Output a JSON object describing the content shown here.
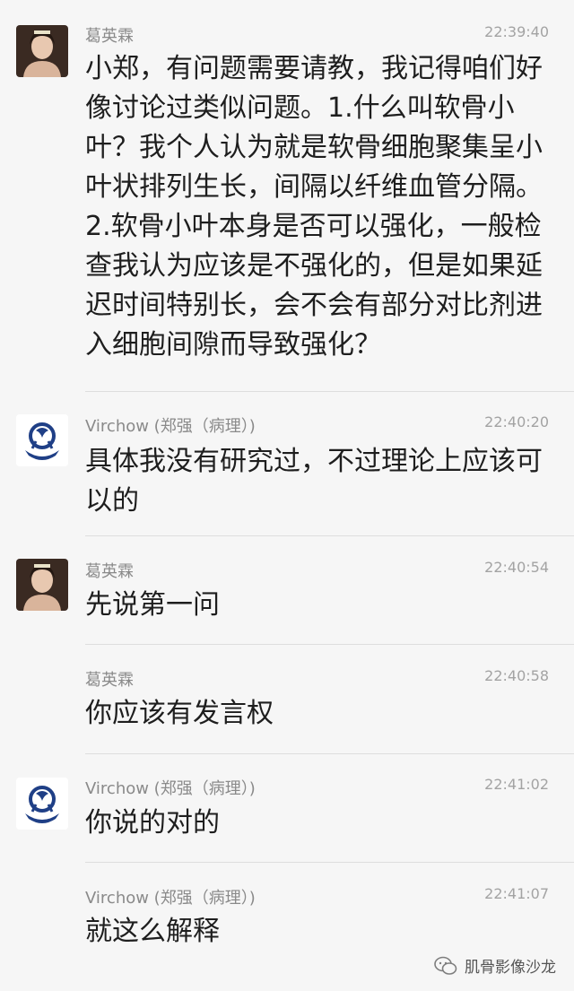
{
  "messages": [
    {
      "sender": "葛英霖",
      "time": "22:39:40",
      "avatar": "female-portrait",
      "text": "小郑，有问题需要请教，我记得咱们好像讨论过类似问题。1.什么叫软骨小叶？我个人认为就是软骨细胞聚集呈小叶状排列生长，间隔以纤维血管分隔。2.软骨小叶本身是否可以强化，一般检查我认为应该是不强化的，但是如果延迟时间特别长，会不会有部分对比剂进入细胞间隙而导致强化？"
    },
    {
      "sender": "Virchow (郑强（病理）)",
      "time": "22:40:20",
      "avatar": "blue-emblem",
      "text": "具体我没有研究过，不过理论上应该可以的"
    },
    {
      "sender": "葛英霖",
      "time": "22:40:54",
      "avatar": "female-portrait",
      "text": "先说第一问"
    },
    {
      "sender": "葛英霖",
      "time": "22:40:58",
      "avatar": "",
      "text": "你应该有发言权"
    },
    {
      "sender": "Virchow (郑强（病理）)",
      "time": "22:41:02",
      "avatar": "blue-emblem",
      "text": "你说的对的"
    },
    {
      "sender": "Virchow (郑强（病理）)",
      "time": "22:41:07",
      "avatar": "",
      "text": "就这么解释"
    }
  ],
  "watermark": {
    "label": "肌骨影像沙龙",
    "icon": "wechat-icon"
  },
  "colors": {
    "background": "#f6f6f6",
    "text": "#1e1e1e",
    "meta": "#8a8a8a",
    "emblem": "#1f3f86"
  }
}
